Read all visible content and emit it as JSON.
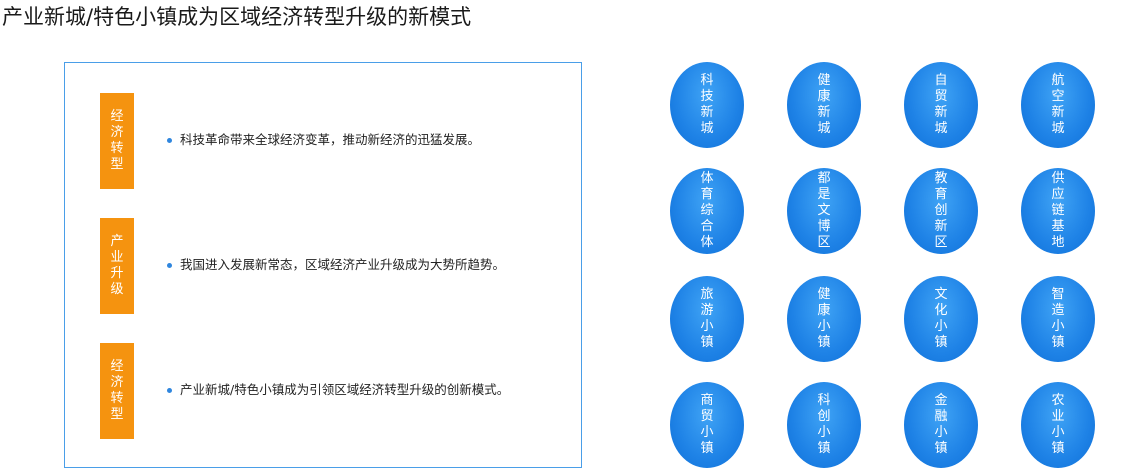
{
  "header": {
    "title": "产业新城/特色小镇成为区域经济转型升级的新模式"
  },
  "panel": {
    "rows": [
      {
        "tag": "经济转型",
        "text": "科技革命带来全球经济变革，推动新经济的迅猛发展。"
      },
      {
        "tag": "产业升级",
        "text": "我国进入发展新常态，区域经济产业升级成为大势所趋势。"
      },
      {
        "tag": "经济转型",
        "text": "产业新城/特色小镇成为引领区域经济转型升级的创新模式。"
      }
    ]
  },
  "circles": [
    "科技新城",
    "健康新城",
    "自贸新城",
    "航空新城",
    "体育综合体",
    "都是文博区",
    "教育创新区",
    "供应链基地",
    "旅游小镇",
    "健康小镇",
    "文化小镇",
    "智造小镇",
    "商贸小镇",
    "科创小镇",
    "金融小镇",
    "农业小镇"
  ],
  "colors": {
    "tag_orange": "#f5930f",
    "circle_blue": "#1e82e6",
    "panel_border": "#4a9ee8",
    "bullet_blue": "#2f86de"
  }
}
